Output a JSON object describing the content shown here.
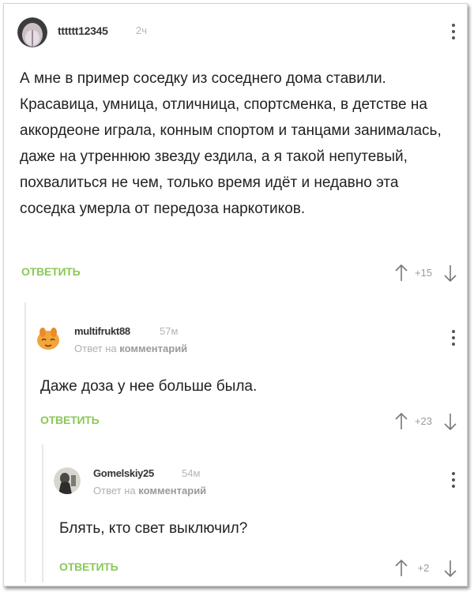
{
  "comments": [
    {
      "username": "tttttt12345",
      "time": "2ч",
      "text": "А мне в пример соседку из соседнего дома ставили. Красавица, умница, отличница, спортсменка, в детстве на аккордеоне играла, конным спортом и танцами занималась, даже на утреннюю звезду ездила, а я такой непутевый, похвалиться не чем, только время идёт и недавно эта соседка умерла от передоза наркотиков.",
      "reply_label": "ОТВЕТИТЬ",
      "score": "+15"
    },
    {
      "username": "multifrukt88",
      "time": "57м",
      "reply_prefix": "Ответ на",
      "reply_target": "комментарий",
      "text": "Даже доза у нее больше была.",
      "reply_label": "ОТВЕТИТЬ",
      "score": "+23"
    },
    {
      "username": "Gomelskiy25",
      "time": "54м",
      "reply_prefix": "Ответ на",
      "reply_target": "комментарий",
      "text": "Блять, кто свет выключил?",
      "reply_label": "ОТВЕТИТЬ",
      "score": "+2"
    }
  ],
  "icons": {
    "upvote": "arrow-up-icon",
    "downvote": "arrow-down-icon",
    "menu": "more-vertical-icon"
  },
  "colors": {
    "reply_accent": "#8ac858",
    "muted": "#b0b0b0"
  }
}
